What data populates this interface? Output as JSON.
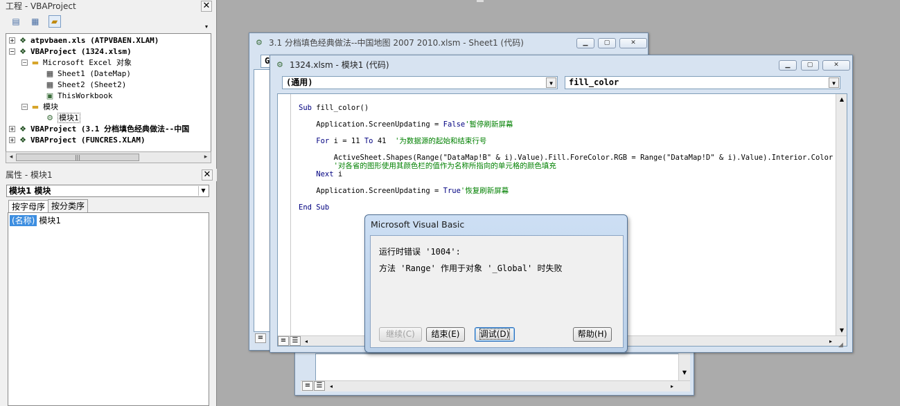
{
  "project_pane": {
    "title": "工程 - VBAProject",
    "toolbar": [
      "view-code",
      "view-object",
      "toggle-folders"
    ],
    "tree": [
      {
        "label": "atpvbaen.xls (ATPVBAEN.XLAM)",
        "icon": "vba-project-icon",
        "expander": "+",
        "bold": true
      },
      {
        "label": "VBAProject (1324.xlsm)",
        "icon": "vba-project-icon",
        "expander": "-",
        "bold": true
      },
      {
        "label": "Microsoft Excel 对象",
        "icon": "folder-icon",
        "expander": "-",
        "bold": false
      },
      {
        "label": "Sheet1 (DateMap)",
        "icon": "sheet-icon",
        "expander": "",
        "bold": false
      },
      {
        "label": "Sheet2 (Sheet2)",
        "icon": "sheet-icon",
        "expander": "",
        "bold": false
      },
      {
        "label": "ThisWorkbook",
        "icon": "workbook-icon",
        "expander": "",
        "bold": false
      },
      {
        "label": "模块",
        "icon": "folder-icon",
        "expander": "-",
        "bold": false
      },
      {
        "label": "模块1",
        "icon": "module-icon",
        "expander": "",
        "bold": false
      },
      {
        "label": "VBAProject (3.1 分档填色经典做法--中国",
        "icon": "vba-project-icon",
        "expander": "+",
        "bold": true
      },
      {
        "label": "VBAProject (FUNCRES.XLAM)",
        "icon": "vba-project-icon",
        "expander": "+",
        "bold": true
      }
    ]
  },
  "properties_pane": {
    "title": "属性 - 模块1",
    "object_select": "模块1 模块",
    "tabs": [
      "按字母序",
      "按分类序"
    ],
    "rows": [
      {
        "key": "(名称)",
        "value": "模块1"
      }
    ]
  },
  "back_window": {
    "title": "3.1 分档填色经典做法--中国地图 2007 2010.xlsm - Sheet1 (代码)"
  },
  "front_window": {
    "title": "1324.xlsm - 模块1 (代码)",
    "object_combo": "(通用)",
    "procedure_combo": "fill_color",
    "code": [
      {
        "kw": "Sub",
        "text": " fill_color()",
        "cmt": ""
      },
      {
        "kw": "",
        "text": "    Application.ScreenUpdating = ",
        "kw2": "False",
        "cmt": "'暂停刷新屏幕"
      },
      {
        "kw": "    For",
        "text": " i = 11 ",
        "kw2": "To",
        "text2": " 41",
        "cmt": "  '为数据源的起始和结束行号"
      },
      {
        "kw": "",
        "text": "        ActiveSheet.Shapes(Range(\"DataMap!B\" & i).Value).Fill.ForeColor.RGB = Range(\"DataMap!D\" & i).Value).Interior.Color",
        "cmt": ""
      },
      {
        "kw": "",
        "text": "",
        "cmt": "        '对各省的图形使用其颜色栏的值作为名称所指向的单元格的颜色填充"
      },
      {
        "kw": "    Next",
        "text": " i",
        "cmt": ""
      },
      {
        "kw": "",
        "text": "    Application.ScreenUpdating = ",
        "kw2": "True",
        "cmt": "'恢复刷新屏幕"
      },
      {
        "kw": "End Sub",
        "text": "",
        "cmt": ""
      }
    ]
  },
  "dialog": {
    "title": "Microsoft Visual Basic",
    "error_line": "运行时错误 '1004':",
    "message": "方法 'Range' 作用于对象 '_Global' 时失败",
    "buttons": {
      "continue": "继续(C)",
      "end": "结束(E)",
      "debug": "调试(D)",
      "help": "帮助(H)"
    }
  },
  "colors": {
    "keyword": "#000080",
    "comment": "#008000",
    "selection": "#3d8ee0",
    "desktop": "#ababab"
  }
}
